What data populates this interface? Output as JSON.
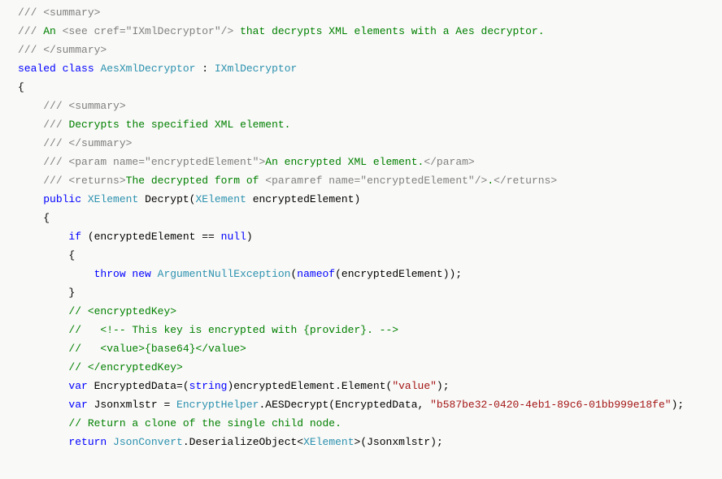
{
  "lines": [
    {
      "indent": 0,
      "segments": [
        {
          "cls": "c-gray",
          "t": "/// <summary>"
        }
      ]
    },
    {
      "indent": 0,
      "segments": [
        {
          "cls": "c-gray",
          "t": "/// "
        },
        {
          "cls": "c-green",
          "t": "An "
        },
        {
          "cls": "c-gray",
          "t": "<see cref=\"IXmlDecryptor\"/>"
        },
        {
          "cls": "c-green",
          "t": " that decrypts XML elements with a Aes decryptor."
        }
      ]
    },
    {
      "indent": 0,
      "segments": [
        {
          "cls": "c-gray",
          "t": "/// </summary>"
        }
      ]
    },
    {
      "indent": 0,
      "segments": [
        {
          "cls": "c-blue",
          "t": "sealed class"
        },
        {
          "cls": "c-black",
          "t": " "
        },
        {
          "cls": "c-type",
          "t": "AesXmlDecryptor"
        },
        {
          "cls": "c-black",
          "t": " : "
        },
        {
          "cls": "c-type",
          "t": "IXmlDecryptor"
        }
      ]
    },
    {
      "indent": 0,
      "segments": [
        {
          "cls": "c-black",
          "t": "{"
        }
      ]
    },
    {
      "indent": 1,
      "segments": [
        {
          "cls": "c-gray",
          "t": "/// <summary>"
        }
      ]
    },
    {
      "indent": 1,
      "segments": [
        {
          "cls": "c-gray",
          "t": "/// "
        },
        {
          "cls": "c-green",
          "t": "Decrypts the specified XML element."
        }
      ]
    },
    {
      "indent": 1,
      "segments": [
        {
          "cls": "c-gray",
          "t": "/// </summary>"
        }
      ]
    },
    {
      "indent": 1,
      "segments": [
        {
          "cls": "c-gray",
          "t": "/// <param name=\"encryptedElement\">"
        },
        {
          "cls": "c-green",
          "t": "An encrypted XML element."
        },
        {
          "cls": "c-gray",
          "t": "</param>"
        }
      ]
    },
    {
      "indent": 1,
      "segments": [
        {
          "cls": "c-gray",
          "t": "/// <returns>"
        },
        {
          "cls": "c-green",
          "t": "The decrypted form of "
        },
        {
          "cls": "c-gray",
          "t": "<paramref name=\"encryptedElement\"/>"
        },
        {
          "cls": "c-green",
          "t": "."
        },
        {
          "cls": "c-gray",
          "t": "</returns>"
        }
      ]
    },
    {
      "indent": 1,
      "segments": [
        {
          "cls": "c-blue",
          "t": "public"
        },
        {
          "cls": "c-black",
          "t": " "
        },
        {
          "cls": "c-type",
          "t": "XElement"
        },
        {
          "cls": "c-black",
          "t": " Decrypt("
        },
        {
          "cls": "c-type",
          "t": "XElement"
        },
        {
          "cls": "c-black",
          "t": " encryptedElement)"
        }
      ]
    },
    {
      "indent": 1,
      "segments": [
        {
          "cls": "c-black",
          "t": "{"
        }
      ]
    },
    {
      "indent": 2,
      "segments": [
        {
          "cls": "c-blue",
          "t": "if"
        },
        {
          "cls": "c-black",
          "t": " (encryptedElement == "
        },
        {
          "cls": "c-blue",
          "t": "null"
        },
        {
          "cls": "c-black",
          "t": ")"
        }
      ]
    },
    {
      "indent": 2,
      "segments": [
        {
          "cls": "c-black",
          "t": "{"
        }
      ]
    },
    {
      "indent": 3,
      "segments": [
        {
          "cls": "c-blue",
          "t": "throw new"
        },
        {
          "cls": "c-black",
          "t": " "
        },
        {
          "cls": "c-type",
          "t": "ArgumentNullException"
        },
        {
          "cls": "c-black",
          "t": "("
        },
        {
          "cls": "c-blue",
          "t": "nameof"
        },
        {
          "cls": "c-black",
          "t": "(encryptedElement));"
        }
      ]
    },
    {
      "indent": 2,
      "segments": [
        {
          "cls": "c-black",
          "t": "}"
        }
      ]
    },
    {
      "indent": 0,
      "segments": [
        {
          "cls": "c-black",
          "t": ""
        }
      ]
    },
    {
      "indent": 2,
      "segments": [
        {
          "cls": "c-green",
          "t": "// <encryptedKey>"
        }
      ]
    },
    {
      "indent": 2,
      "segments": [
        {
          "cls": "c-green",
          "t": "//   <!-- This key is encrypted with {provider}. -->"
        }
      ]
    },
    {
      "indent": 2,
      "segments": [
        {
          "cls": "c-green",
          "t": "//   <value>{base64}</value>"
        }
      ]
    },
    {
      "indent": 2,
      "segments": [
        {
          "cls": "c-green",
          "t": "// </encryptedKey>"
        }
      ]
    },
    {
      "indent": 2,
      "segments": [
        {
          "cls": "c-blue",
          "t": "var"
        },
        {
          "cls": "c-black",
          "t": " EncryptedData=("
        },
        {
          "cls": "c-blue",
          "t": "string"
        },
        {
          "cls": "c-black",
          "t": ")encryptedElement.Element("
        },
        {
          "cls": "c-str",
          "t": "\"value\""
        },
        {
          "cls": "c-black",
          "t": ");"
        }
      ]
    },
    {
      "indent": 2,
      "segments": [
        {
          "cls": "c-blue",
          "t": "var"
        },
        {
          "cls": "c-black",
          "t": " Jsonxmlstr = "
        },
        {
          "cls": "c-type",
          "t": "EncryptHelper"
        },
        {
          "cls": "c-black",
          "t": ".AESDecrypt(EncryptedData, "
        },
        {
          "cls": "c-str",
          "t": "\"b587be32-0420-4eb1-89c6-01bb999e18fe\""
        },
        {
          "cls": "c-black",
          "t": ");"
        }
      ]
    },
    {
      "indent": 0,
      "segments": [
        {
          "cls": "c-black",
          "t": ""
        }
      ]
    },
    {
      "indent": 2,
      "segments": [
        {
          "cls": "c-green",
          "t": "// Return a clone of the single child node."
        }
      ]
    },
    {
      "indent": 2,
      "segments": [
        {
          "cls": "c-blue",
          "t": "return"
        },
        {
          "cls": "c-black",
          "t": " "
        },
        {
          "cls": "c-type",
          "t": "JsonConvert"
        },
        {
          "cls": "c-black",
          "t": ".DeserializeObject<"
        },
        {
          "cls": "c-type",
          "t": "XElement"
        },
        {
          "cls": "c-black",
          "t": ">(Jsonxmlstr);"
        }
      ]
    }
  ],
  "indentUnit": "    "
}
